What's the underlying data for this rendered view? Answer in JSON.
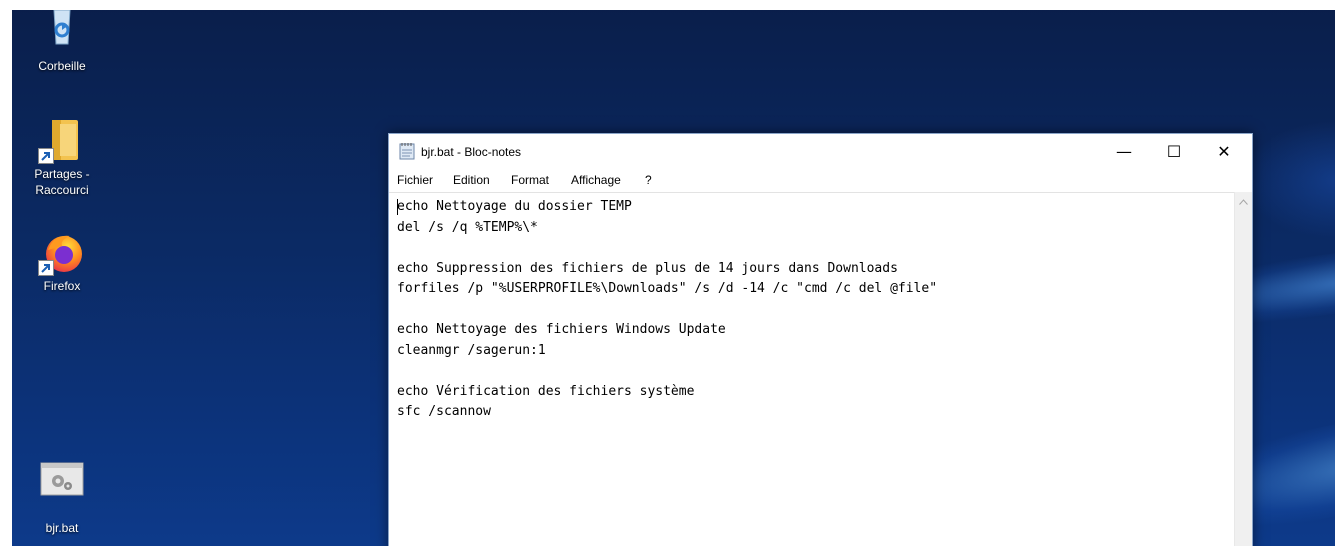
{
  "desktop": {
    "icons": [
      {
        "label": "Corbeille",
        "icon": "recycle-bin-icon"
      },
      {
        "label": "Partages -\nRaccourci",
        "icon": "folder-shortcut-icon"
      },
      {
        "label": "Firefox",
        "icon": "firefox-icon"
      },
      {
        "label": "bjr.bat",
        "icon": "batch-file-icon"
      }
    ]
  },
  "window": {
    "title": "bjr.bat - Bloc-notes",
    "controls": {
      "minimize": "—",
      "maximize": "☐",
      "close": "✕"
    },
    "menu": [
      "Fichier",
      "Edition",
      "Format",
      "Affichage",
      "?"
    ],
    "content_lines": [
      "echo Nettoyage du dossier TEMP",
      "del /s /q %TEMP%\\*",
      "",
      "echo Suppression des fichiers de plus de 14 jours dans Downloads",
      "forfiles /p \"%USERPROFILE%\\Downloads\" /s /d -14 /c \"cmd /c del @file\"",
      "",
      "echo Nettoyage des fichiers Windows Update",
      "cleanmgr /sagerun:1",
      "",
      "echo Vérification des fichiers système",
      "sfc /scannow"
    ]
  },
  "colors": {
    "desktop_bg": "#0b2a64",
    "window_bg": "#ffffff",
    "text": "#000000"
  }
}
